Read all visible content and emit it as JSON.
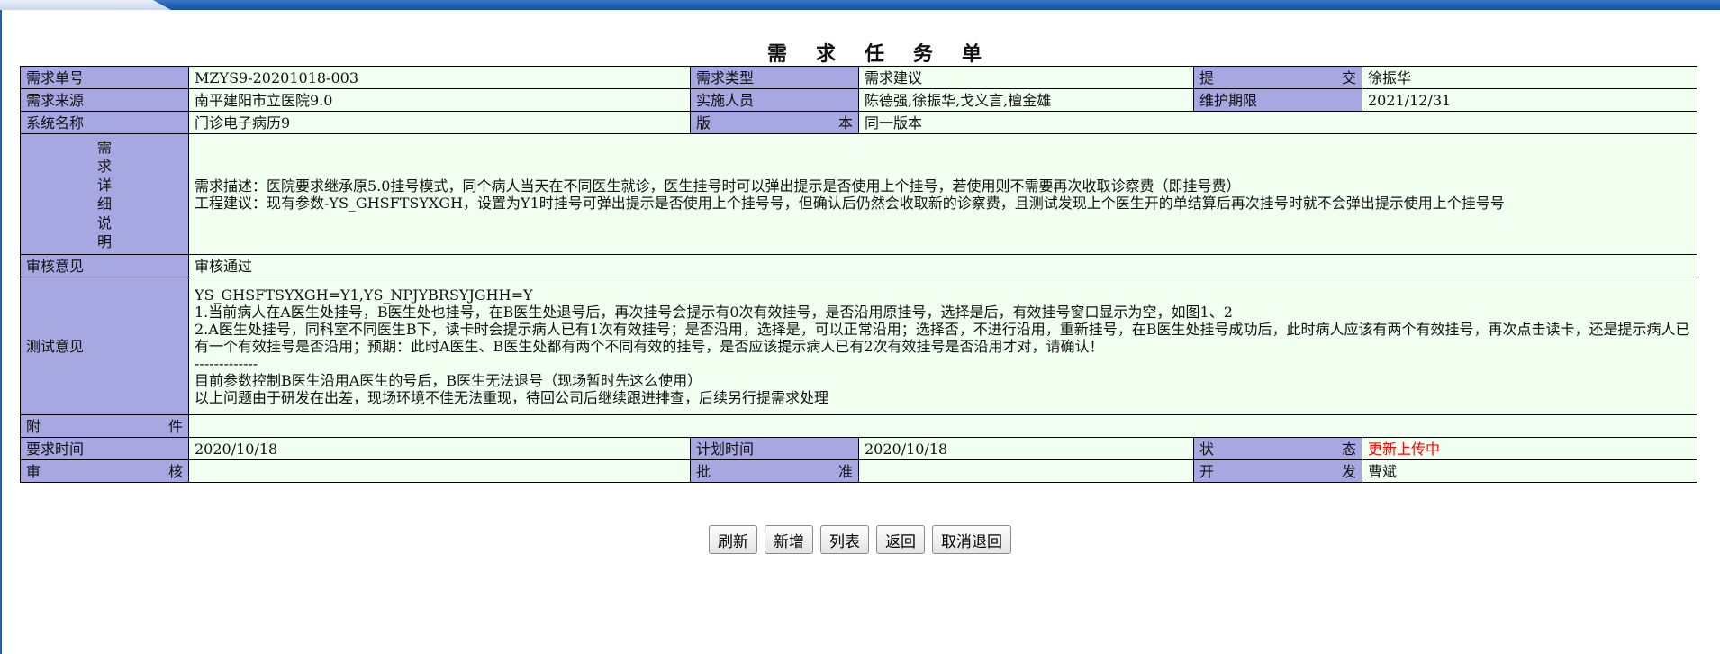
{
  "title": "需求任务单",
  "fields": {
    "req_no_label": "需求单号",
    "req_no": "MZYS9-20201018-003",
    "req_type_label": "需求类型",
    "req_type": "需求建议",
    "submit_label": "提交",
    "submitter": "徐振华",
    "source_label": "需求来源",
    "source": "南平建阳市立医院9.0",
    "impl_label": "实施人员",
    "implementers": "陈德强,徐振华,戈义言,檀金雄",
    "maint_label": "维护期限",
    "maint_date": "2021/12/31",
    "system_label": "系统名称",
    "system": "门诊电子病历9",
    "version_label": "版本",
    "version": "同一版本",
    "detail_label": "需求详细说明",
    "detail": "需求描述：医院要求继承原5.0挂号模式，同个病人当天在不同医生就诊，医生挂号时可以弹出提示是否使用上个挂号，若使用则不需要再次收取诊察费（即挂号费）\n工程建议：现有参数-YS_GHSFTSYXGH，设置为Y1时挂号可弹出提示是否使用上个挂号号，但确认后仍然会收取新的诊察费，且测试发现上个医生开的单结算后再次挂号时就不会弹出提示使用上个挂号号",
    "review_opinion_label": "审核意见",
    "review_opinion": "审核通过",
    "test_opinion_label": "测试意见",
    "test_opinion": "YS_GHSFTSYXGH=Y1,YS_NPJYBRSYJGHH=Y\n1.当前病人在A医生处挂号，B医生处也挂号，在B医生处退号后，再次挂号会提示有0次有效挂号，是否沿用原挂号，选择是后，有效挂号窗口显示为空，如图1、2\n2.A医生处挂号，同科室不同医生B下，读卡时会提示病人已有1次有效挂号；是否沿用，选择是，可以正常沿用；选择否，不进行沿用，重新挂号，在B医生处挂号成功后，此时病人应该有两个有效挂号，再次点击读卡，还是提示病人已有一个有效挂号是否沿用；预期：此时A医生、B医生处都有两个不同有效的挂号，是否应该提示病人已有2次有效挂号是否沿用才对，请确认！\n-------------\n目前参数控制B医生沿用A医生的号后，B医生无法退号（现场暂时先这么使用）\n以上问题由于研发在出差，现场环境不佳无法重现，待回公司后继续跟进排查，后续另行提需求处理",
    "attachment_label": "附件",
    "attachment": "",
    "req_time_label": "要求时间",
    "req_time": "2020/10/18",
    "plan_time_label": "计划时间",
    "plan_time": "2020/10/18",
    "status_label": "状态",
    "status": "更新上传中",
    "audit_label": "审核",
    "audit": "",
    "approve_label": "批准",
    "approve": "",
    "dev_label": "开发",
    "developer": "曹斌"
  },
  "buttons": {
    "refresh": "刷新",
    "add": "新增",
    "list": "列表",
    "back": "返回",
    "cancel_return": "取消退回"
  },
  "colors": {
    "label_bg": "#a7a7e1",
    "value_bg": "#f0fff0",
    "status_text": "#ff0000"
  }
}
